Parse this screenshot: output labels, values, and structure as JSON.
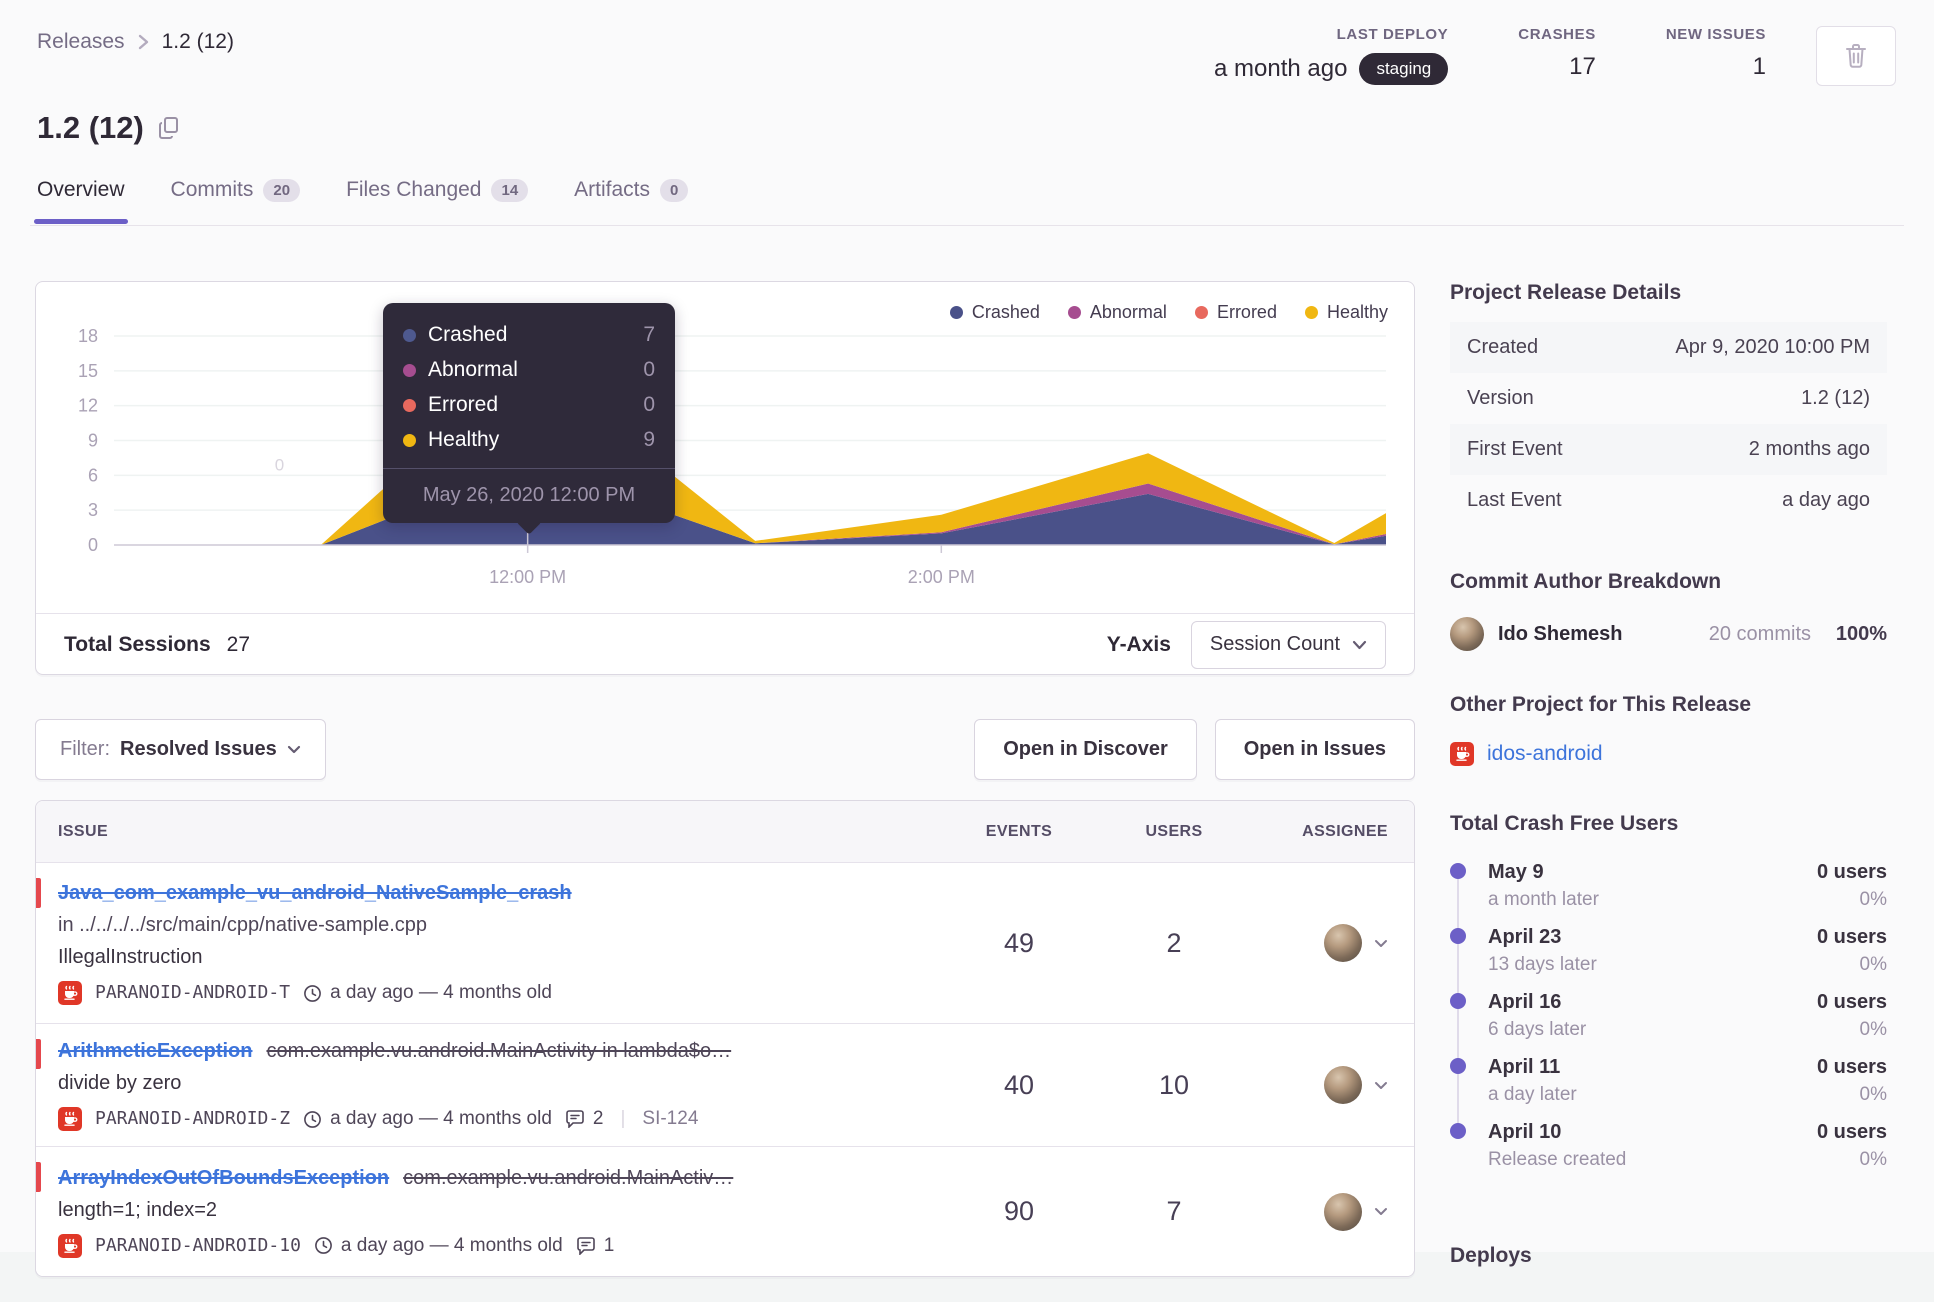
{
  "colors": {
    "accent": "#6C5FC7",
    "crashed": "#4A5189",
    "abnormal": "#A64D90",
    "errored": "#E8695E",
    "healthy": "#F0B712",
    "link_blue": "#3D74DB",
    "project_icon_red": "#E03727",
    "staging_pill_bg": "#2F2936"
  },
  "breadcrumb": {
    "root": "Releases",
    "current": "1.2 (12)"
  },
  "header_stats": {
    "last_deploy_label": "LAST DEPLOY",
    "last_deploy_value": "a month ago",
    "environment": "staging",
    "crashes_label": "CRASHES",
    "crashes_value": "17",
    "new_issues_label": "NEW ISSUES",
    "new_issues_value": "1"
  },
  "page_title": "1.2 (12)",
  "tabs": [
    {
      "label": "Overview"
    },
    {
      "label": "Commits",
      "badge": "20"
    },
    {
      "label": "Files Changed",
      "badge": "14"
    },
    {
      "label": "Artifacts",
      "badge": "0"
    }
  ],
  "chart_data": {
    "type": "area",
    "stacked": true,
    "x_unit": "hour_of_day",
    "x_hours": [
      10,
      11,
      12,
      13.1,
      14,
      15,
      15.9,
      16.15
    ],
    "series": [
      {
        "name": "Crashed",
        "color": "#4A5189",
        "values": [
          0,
          0,
          7,
          0.15,
          1.0,
          4.4,
          0.05,
          0.8
        ]
      },
      {
        "name": "Abnormal",
        "color": "#A64D90",
        "values": [
          0,
          0,
          0,
          0,
          0.1,
          0.9,
          0.02,
          0.15
        ]
      },
      {
        "name": "Errored",
        "color": "#E8695E",
        "values": [
          0,
          0,
          0,
          0,
          0,
          0,
          0,
          0
        ]
      },
      {
        "name": "Healthy",
        "color": "#F0B712",
        "values": [
          0,
          0,
          9,
          0.2,
          1.5,
          2.6,
          0.1,
          1.8
        ]
      }
    ],
    "y_ticks": [
      0,
      3,
      6,
      9,
      12,
      15,
      18
    ],
    "x_ticks": [
      {
        "hour": 12,
        "label": "12:00 PM"
      },
      {
        "hour": 14,
        "label": "2:00 PM"
      }
    ],
    "ylim": [
      0,
      19.5
    ],
    "grid": true,
    "legend_position": "top-right",
    "hover_hour": 12,
    "annotation": {
      "text": "0",
      "hour": 10.8,
      "value": 6.4
    }
  },
  "tooltip": {
    "rows": [
      {
        "label": "Crashed",
        "value": "7",
        "color": "#4E598F"
      },
      {
        "label": "Abnormal",
        "value": "0",
        "color": "#A64D90"
      },
      {
        "label": "Errored",
        "value": "0",
        "color": "#E8695E"
      },
      {
        "label": "Healthy",
        "value": "9",
        "color": "#F0B712"
      }
    ],
    "date": "May 26, 2020 12:00 PM"
  },
  "chart_footer": {
    "total_label": "Total Sessions",
    "total_value": "27",
    "yaxis_label": "Y-Axis",
    "yaxis_value": "Session Count"
  },
  "filter_bar": {
    "filter_prefix": "Filter:",
    "filter_value": "Resolved Issues",
    "discover_button": "Open in Discover",
    "issues_button": "Open in Issues"
  },
  "issues_table": {
    "headers": {
      "issue": "ISSUE",
      "events": "EVENTS",
      "users": "USERS",
      "assignee": "ASSIGNEE"
    },
    "rows": [
      {
        "title": "Java_com_example_vu_android_NativeSample_crash",
        "location": "in ../../../../src/main/cpp/native-sample.cpp",
        "message": "IllegalInstruction",
        "project": "PARANOID-ANDROID-T",
        "age": "a day ago — 4 months old",
        "events": "49",
        "users": "2"
      },
      {
        "title": "ArithmeticException",
        "culprit": "com.example.vu.android.MainActivity in lambda$o…",
        "message": "divide by zero",
        "project": "PARANOID-ANDROID-Z",
        "age": "a day ago — 4 months old",
        "comments": "2",
        "annotation": "SI-124",
        "events": "40",
        "users": "10"
      },
      {
        "title": "ArrayIndexOutOfBoundsException",
        "culprit": "com.example.vu.android.MainActiv…",
        "message": "length=1; index=2",
        "project": "PARANOID-ANDROID-10",
        "age": "a day ago — 4 months old",
        "comments": "1",
        "events": "90",
        "users": "7"
      }
    ]
  },
  "sidebar": {
    "details": {
      "heading": "Project Release Details",
      "rows": [
        [
          "Created",
          "Apr 9, 2020 10:00 PM"
        ],
        [
          "Version",
          "1.2 (12)"
        ],
        [
          "First Event",
          "2 months ago"
        ],
        [
          "Last Event",
          "a day ago"
        ]
      ]
    },
    "authors": {
      "heading": "Commit Author Breakdown",
      "name": "Ido Shemesh",
      "commits": "20 commits",
      "percent": "100%"
    },
    "other_project": {
      "heading": "Other Project for This Release",
      "link": "idos-android"
    },
    "crash_free": {
      "heading": "Total Crash Free Users",
      "items": [
        {
          "date": "May 9",
          "sub": "a month later",
          "users": "0 users",
          "pct": "0%"
        },
        {
          "date": "April 23",
          "sub": "13 days later",
          "users": "0 users",
          "pct": "0%"
        },
        {
          "date": "April 16",
          "sub": "6 days later",
          "users": "0 users",
          "pct": "0%"
        },
        {
          "date": "April 11",
          "sub": "a day later",
          "users": "0 users",
          "pct": "0%"
        },
        {
          "date": "April 10",
          "sub": "Release created",
          "users": "0 users",
          "pct": "0%"
        }
      ]
    },
    "deploys_heading": "Deploys"
  }
}
